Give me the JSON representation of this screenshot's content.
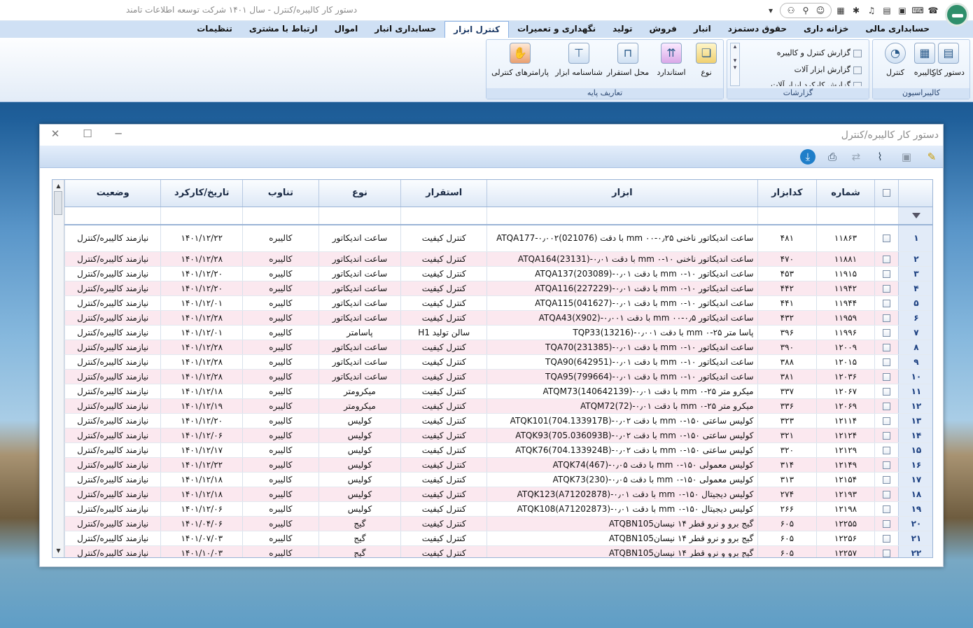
{
  "app": {
    "title": "دستور کار کالیبره/کنترل  -  سال ۱۴۰۱ شرکت توسعه اطلاعات تامند"
  },
  "tabs": [
    "حسابداری مالی",
    "خزانه داری",
    "حقوق دستمزد",
    "انبار",
    "فروش",
    "تولید",
    "نگهداری و تعمیرات",
    "کنترل ابزار",
    "حسابداری انبار",
    "اموال",
    "ارتباط با مشتری",
    "تنظیمات"
  ],
  "active_tab": "کنترل ابزار",
  "ribbon": {
    "calib_group": {
      "label": "کالیبراسیون",
      "buttons": [
        "دستور کار",
        "کالیبره",
        "کنترل"
      ]
    },
    "reports_group": {
      "label": "گزارشات",
      "items": [
        "گزارش کنترل و کالیبره",
        "گزارش ابزار آلات",
        "گزارش کارکرد ابزار آلات"
      ]
    },
    "base_group": {
      "label": "تعاریف پایه",
      "buttons": [
        "نوع",
        "استاندارد",
        "محل استقرار",
        "شناسنامه ابزار",
        "پارامترهای کنترلی"
      ]
    }
  },
  "window": {
    "title": "دستور کار کالیبره/کنترل"
  },
  "columns": {
    "num": "",
    "check": "",
    "shomare": "شماره",
    "kod": "کدابزار",
    "abzar": "ابزار",
    "esteghrar": "استقرار",
    "noe": "نوع",
    "tanavob": "تناوب",
    "date": "تاریخ/کارکرد",
    "vaziat": "وضعیت"
  },
  "rows": [
    {
      "n": "۱",
      "shomare": "۱۱۸۶۳",
      "kod": "۴۸۱",
      "abzar": "ساعت اندیکاتور ناخنی ۰٫۲۵-۰۰ mm با دقت ATQA177-۰٫۰۰۲(021076)",
      "esteghrar": "کنترل کیفیت",
      "noe": "ساعت اندیکاتور",
      "tanavob": "کالیبره",
      "date": "۱۴۰۱/۱۲/۲۲",
      "vaziat": "نیازمند کالیبره/کنترل"
    },
    {
      "n": "۲",
      "shomare": "۱۱۸۸۱",
      "kod": "۴۷۰",
      "abzar": "ساعت اندیکاتور ناخنی ۱۰-۰ mm با دقت ۰٫۰۱-ATQA164(23131)",
      "esteghrar": "کنترل کیفیت",
      "noe": "ساعت اندیکاتور",
      "tanavob": "کالیبره",
      "date": "۱۴۰۱/۱۲/۲۸",
      "vaziat": "نیازمند کالیبره/کنترل"
    },
    {
      "n": "۳",
      "shomare": "۱۱۹۱۵",
      "kod": "۴۵۳",
      "abzar": "ساعت اندیکاتور ۱۰-۰ mm با دقت ۰٫۰۱-ATQA137(203089)",
      "esteghrar": "کنترل کیفیت",
      "noe": "ساعت اندیکاتور",
      "tanavob": "کالیبره",
      "date": "۱۴۰۱/۱۲/۲۰",
      "vaziat": "نیازمند کالیبره/کنترل"
    },
    {
      "n": "۴",
      "shomare": "۱۱۹۴۲",
      "kod": "۴۴۲",
      "abzar": "ساعت اندیکاتور ۱۰-۰ mm با دقت ۰٫۰۱-ATQA116(227229)",
      "esteghrar": "کنترل کیفیت",
      "noe": "ساعت اندیکاتور",
      "tanavob": "کالیبره",
      "date": "۱۴۰۱/۱۲/۲۰",
      "vaziat": "نیازمند کالیبره/کنترل"
    },
    {
      "n": "۵",
      "shomare": "۱۱۹۴۴",
      "kod": "۴۴۱",
      "abzar": "ساعت اندیکاتور ۱۰-۰ mm با دقت ۰٫۰۱-ATQA115(041627)",
      "esteghrar": "کنترل کیفیت",
      "noe": "ساعت اندیکاتور",
      "tanavob": "کالیبره",
      "date": "۱۴۰۱/۱۲/۰۱",
      "vaziat": "نیازمند کالیبره/کنترل"
    },
    {
      "n": "۶",
      "shomare": "۱۱۹۵۹",
      "kod": "۴۳۲",
      "abzar": "ساعت اندیکاتور ۰٫۵-۰۰ mm با دقت ۰٫۰۰۱-ATQA43(X902)",
      "esteghrar": "کنترل کیفیت",
      "noe": "ساعت اندیکاتور",
      "tanavob": "کالیبره",
      "date": "۱۴۰۱/۱۲/۲۸",
      "vaziat": "نیازمند کالیبره/کنترل"
    },
    {
      "n": "۷",
      "shomare": "۱۱۹۹۶",
      "kod": "۳۹۶",
      "abzar": "پاسا متر ۲۵-۰ mm با دقت ۰٫۰۰۱-TQP33(13216)",
      "esteghrar": "سالن تولید H1",
      "noe": "پاسامتر",
      "tanavob": "کالیبره",
      "date": "۱۴۰۱/۱۲/۰۱",
      "vaziat": "نیازمند کالیبره/کنترل"
    },
    {
      "n": "۸",
      "shomare": "۱۲۰۰۹",
      "kod": "۳۹۰",
      "abzar": "ساعت اندیکاتور ۱۰-۰ mm با دقت ۰٫۰۱-TQA70(231385)",
      "esteghrar": "کنترل کیفیت",
      "noe": "ساعت اندیکاتور",
      "tanavob": "کالیبره",
      "date": "۱۴۰۱/۱۲/۲۸",
      "vaziat": "نیازمند کالیبره/کنترل"
    },
    {
      "n": "۹",
      "shomare": "۱۲۰۱۵",
      "kod": "۳۸۸",
      "abzar": "ساعت اندیکاتور ۱۰-۰ mm با دقت ۰٫۰۱-TQA90(642951)",
      "esteghrar": "کنترل کیفیت",
      "noe": "ساعت اندیکاتور",
      "tanavob": "کالیبره",
      "date": "۱۴۰۱/۱۲/۲۸",
      "vaziat": "نیازمند کالیبره/کنترل"
    },
    {
      "n": "۱۰",
      "shomare": "۱۲۰۳۶",
      "kod": "۳۸۱",
      "abzar": "ساعت اندیکاتور ۱۰-۰ mm با دقت ۰٫۰۱-TQA95(799664)",
      "esteghrar": "کنترل کیفیت",
      "noe": "ساعت اندیکاتور",
      "tanavob": "کالیبره",
      "date": "۱۴۰۱/۱۲/۲۸",
      "vaziat": "نیازمند کالیبره/کنترل"
    },
    {
      "n": "۱۱",
      "shomare": "۱۲۰۶۷",
      "kod": "۳۳۷",
      "abzar": "میکرو متر ۲۵-۰ mm با دقت ۰٫۰۱-ATQM73(140642139)",
      "esteghrar": "کنترل کیفیت",
      "noe": "میکرومتر",
      "tanavob": "کالیبره",
      "date": "۱۴۰۱/۱۲/۱۸",
      "vaziat": "نیازمند کالیبره/کنترل"
    },
    {
      "n": "۱۲",
      "shomare": "۱۲۰۶۹",
      "kod": "۳۳۶",
      "abzar": "میکرو متر ۲۵-۰ mm با دقت ۰٫۰۱-ATQM72(72)",
      "esteghrar": "کنترل کیفیت",
      "noe": "میکرومتر",
      "tanavob": "کالیبره",
      "date": "۱۴۰۱/۱۲/۱۹",
      "vaziat": "نیازمند کالیبره/کنترل"
    },
    {
      "n": "۱۳",
      "shomare": "۱۲۱۱۴",
      "kod": "۳۲۳",
      "abzar": "کولیس ساعتی ۱۵۰-۰ mm با دقت ۰٫۰۲-ATQK101(704.133917B)",
      "esteghrar": "کنترل کیفیت",
      "noe": "کولیس",
      "tanavob": "کالیبره",
      "date": "۱۴۰۱/۱۲/۲۰",
      "vaziat": "نیازمند کالیبره/کنترل"
    },
    {
      "n": "۱۴",
      "shomare": "۱۲۱۲۴",
      "kod": "۳۲۱",
      "abzar": "کولیس ساعتی ۱۵۰-۰ mm با دقت ۰٫۰۲-ATQK93(705.036093B)",
      "esteghrar": "کنترل کیفیت",
      "noe": "کولیس",
      "tanavob": "کالیبره",
      "date": "۱۴۰۱/۱۲/۰۶",
      "vaziat": "نیازمند کالیبره/کنترل"
    },
    {
      "n": "۱۵",
      "shomare": "۱۲۱۲۹",
      "kod": "۳۲۰",
      "abzar": "کولیس ساعتی ۱۵۰-۰ mm با دقت ۰٫۰۲-ATQK76(704.133924B)",
      "esteghrar": "کنترل کیفیت",
      "noe": "کولیس",
      "tanavob": "کالیبره",
      "date": "۱۴۰۱/۱۲/۱۷",
      "vaziat": "نیازمند کالیبره/کنترل"
    },
    {
      "n": "۱۶",
      "shomare": "۱۲۱۴۹",
      "kod": "۳۱۴",
      "abzar": "کولیس معمولی ۱۵۰-۰ mm با دقت ۰٫۰۵-ATQK74(467)",
      "esteghrar": "کنترل کیفیت",
      "noe": "کولیس",
      "tanavob": "کالیبره",
      "date": "۱۴۰۱/۱۲/۲۲",
      "vaziat": "نیازمند کالیبره/کنترل"
    },
    {
      "n": "۱۷",
      "shomare": "۱۲۱۵۴",
      "kod": "۳۱۳",
      "abzar": "کولیس معمولی ۱۵۰-۰ mm با دقت ۰٫۰۵-ATQK73(230)",
      "esteghrar": "کنترل کیفیت",
      "noe": "کولیس",
      "tanavob": "کالیبره",
      "date": "۱۴۰۱/۱۲/۱۸",
      "vaziat": "نیازمند کالیبره/کنترل"
    },
    {
      "n": "۱۸",
      "shomare": "۱۲۱۹۳",
      "kod": "۲۷۴",
      "abzar": "کولیس دیجیتال ۱۵۰-۰ mm با دقت ۰٫۰۱-ATQK123(A71202878)",
      "esteghrar": "کنترل کیفیت",
      "noe": "کولیس",
      "tanavob": "کالیبره",
      "date": "۱۴۰۱/۱۲/۱۸",
      "vaziat": "نیازمند کالیبره/کنترل"
    },
    {
      "n": "۱۹",
      "shomare": "۱۲۱۹۸",
      "kod": "۲۶۶",
      "abzar": "کولیس دیجیتال ۱۵۰-۰ mm با دقت ۰٫۰۱-ATQK108(A71202873)",
      "esteghrar": "کنترل کیفیت",
      "noe": "کولیس",
      "tanavob": "کالیبره",
      "date": "۱۴۰۱/۱۲/۰۶",
      "vaziat": "نیازمند کالیبره/کنترل"
    },
    {
      "n": "۲۰",
      "shomare": "۱۲۲۵۵",
      "kod": "۶۰۵",
      "abzar": "گیج برو و نرو قطر ۱۴ نیسانATQBN105",
      "esteghrar": "کنترل کیفیت",
      "noe": "گیج",
      "tanavob": "کالیبره",
      "date": "۱۴۰۱/۰۴/۰۶",
      "vaziat": "نیازمند کالیبره/کنترل"
    },
    {
      "n": "۲۱",
      "shomare": "۱۲۲۵۶",
      "kod": "۶۰۵",
      "abzar": "گیج برو و نرو قطر ۱۴ نیسانATQBN105",
      "esteghrar": "کنترل کیفیت",
      "noe": "گیج",
      "tanavob": "کالیبره",
      "date": "۱۴۰۱/۰۷/۰۳",
      "vaziat": "نیازمند کالیبره/کنترل"
    },
    {
      "n": "۲۲",
      "shomare": "۱۲۲۵۷",
      "kod": "۶۰۵",
      "abzar": "گیج برو و نرو قطر ۱۴ نیسانATQBN105",
      "esteghrar": "کنترل کیفیت",
      "noe": "گیج",
      "tanavob": "کالیبره",
      "date": "۱۴۰۱/۱۰/۰۳",
      "vaziat": "نیازمند کالیبره/کنترل"
    }
  ]
}
